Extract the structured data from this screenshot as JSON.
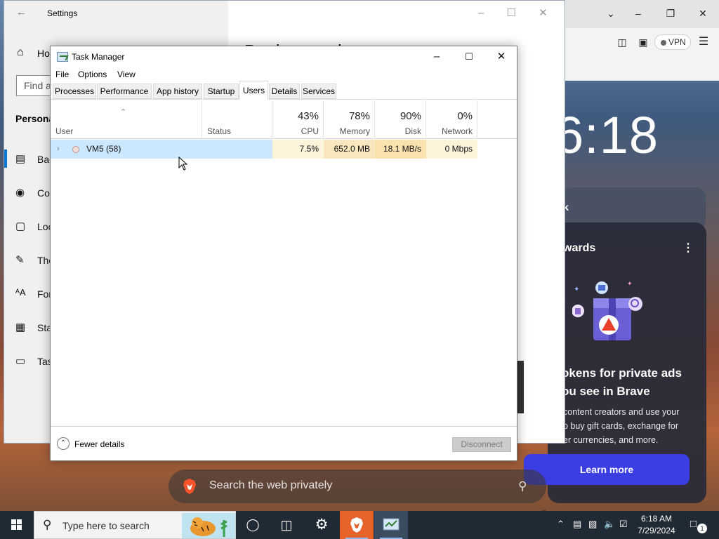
{
  "settings": {
    "title": "Settings",
    "home_label": "Ho",
    "find_placeholder": "Find a",
    "section_title": "Persona",
    "page_heading": "Background",
    "nav_items": [
      {
        "label": "Bac",
        "icon": "image-icon"
      },
      {
        "label": "Col",
        "icon": "palette-icon"
      },
      {
        "label": "Loc",
        "icon": "lockscreen-icon"
      },
      {
        "label": "The",
        "icon": "theme-brush-icon"
      },
      {
        "label": "For",
        "icon": "fonts-icon"
      },
      {
        "label": "Sta",
        "icon": "start-grid-icon"
      },
      {
        "label": "Tas",
        "icon": "taskbar-icon"
      }
    ]
  },
  "brave": {
    "vpn_label": "VPN",
    "clock_fragment": "6:18",
    "card_fragment": "k",
    "rewards_title": "wards",
    "rewards_heading_line1": "okens for private ads",
    "rewards_heading_line2": "ou see in Brave",
    "rewards_desc_line1": "content creators and use your",
    "rewards_desc_line2": "o buy gift cards, exchange for",
    "rewards_desc_line3": "er currencies, and more.",
    "learn_more": "Learn more",
    "search_placeholder": "Search the web privately"
  },
  "task_manager": {
    "title": "Task Manager",
    "menu": [
      "File",
      "Options",
      "View"
    ],
    "tabs": [
      "Processes",
      "Performance",
      "App history",
      "Startup",
      "Users",
      "Details",
      "Services"
    ],
    "active_tab": "Users",
    "columns": {
      "user": "User",
      "status": "Status",
      "cpu": {
        "label": "CPU",
        "pct": "43%"
      },
      "memory": {
        "label": "Memory",
        "pct": "78%"
      },
      "disk": {
        "label": "Disk",
        "pct": "90%"
      },
      "network": {
        "label": "Network",
        "pct": "0%"
      }
    },
    "rows": [
      {
        "user": "VM5 (58)",
        "status": "",
        "cpu": "7.5%",
        "memory": "652.0 MB",
        "disk": "18.1 MB/s",
        "network": "0 Mbps"
      }
    ],
    "fewer_details": "Fewer details",
    "disconnect": "Disconnect"
  },
  "taskbar": {
    "search_placeholder": "Type here to search",
    "time": "6:18 AM",
    "date": "7/29/2024",
    "notification_count": "1"
  },
  "colors": {
    "cpu_heat": "#fdf4dc",
    "memory_heat": "#f9e7bf",
    "disk_heat": "#f9e2b0",
    "network_heat": "#fdf4dc",
    "row_highlight": "#cce8ff",
    "brave_accent": "#3b3ee3",
    "taskbar": "#1f2a34"
  }
}
